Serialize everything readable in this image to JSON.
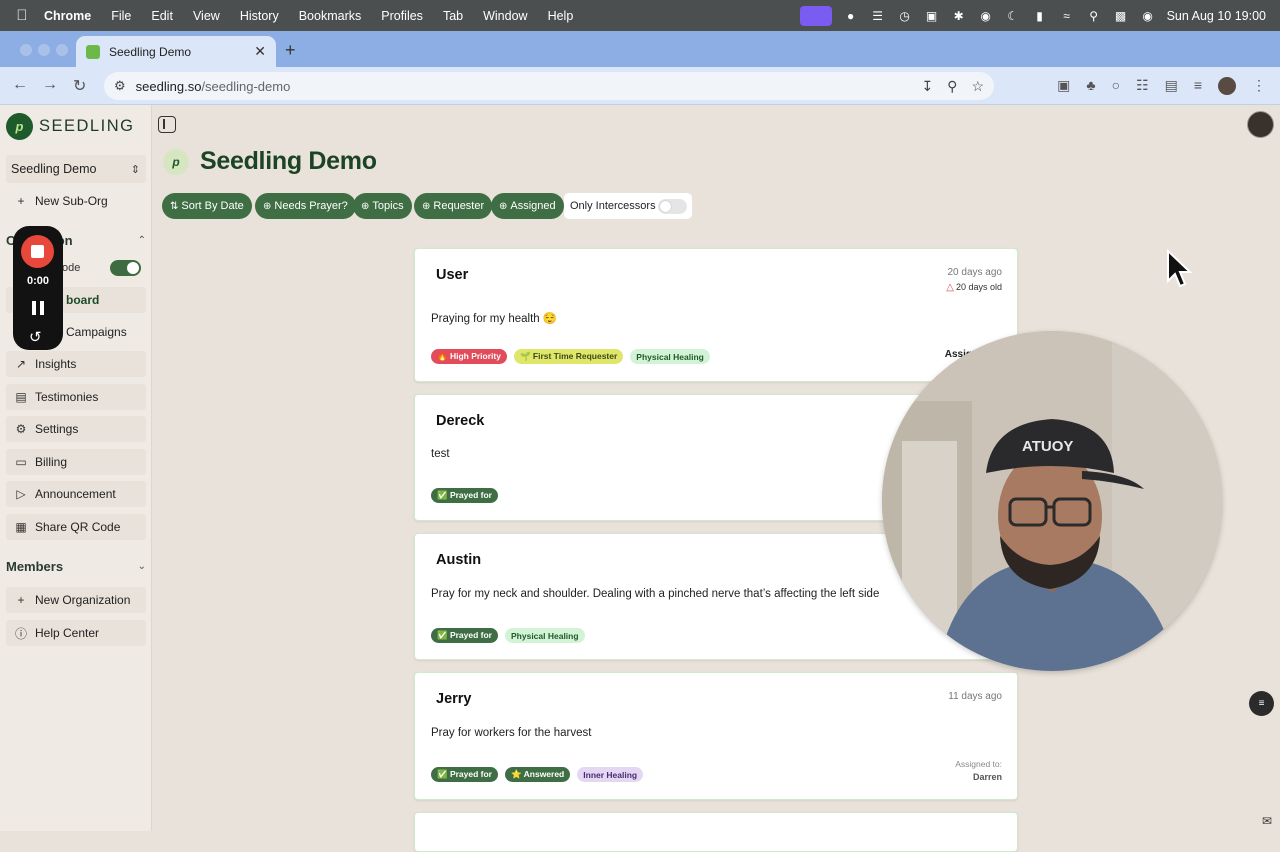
{
  "menubar": {
    "apple": "",
    "items": [
      "Chrome",
      "File",
      "Edit",
      "View",
      "History",
      "Bookmarks",
      "Profiles",
      "Tab",
      "Window",
      "Help"
    ],
    "datetime": "Sun Aug 10  19:00"
  },
  "browser": {
    "tab_title": "Seedling Demo",
    "url_host": "seedling.so",
    "url_path": "/seedling-demo"
  },
  "sidebar": {
    "brand": "SEEDLING",
    "brand_logo_glyph": "p",
    "org_selector": "Seedling Demo",
    "new_sub_org": "New Sub-Org",
    "section_org_partial_start": "O",
    "section_org_partial_end": "ion",
    "mode_partial": "ode",
    "dashboard_partial": "board",
    "campaigns_partial": "Campaigns",
    "items": [
      {
        "label": "Insights",
        "icon": "chart-icon"
      },
      {
        "label": "Testimonies",
        "icon": "book-icon"
      },
      {
        "label": "Settings",
        "icon": "gear-icon"
      },
      {
        "label": "Billing",
        "icon": "card-icon"
      },
      {
        "label": "Announcement",
        "icon": "megaphone-icon"
      },
      {
        "label": "Share QR Code",
        "icon": "qr-icon"
      }
    ],
    "members_section": "Members",
    "new_organization": "New Organization",
    "help_center": "Help Center"
  },
  "recorder": {
    "time": "0:00"
  },
  "main": {
    "title": "Seedling Demo",
    "filters": [
      "Sort By Date",
      "Needs Prayer?",
      "Topics",
      "Requester",
      "Assigned"
    ],
    "intercessors_label": "Only Intercessors",
    "intercessors_on": false
  },
  "requests": [
    {
      "name": "User",
      "ago": "20 days ago",
      "age_warning": "20 days old",
      "message": "Praying for my health 😌",
      "tags": [
        {
          "label": "🔥 High Priority",
          "kind": "high"
        },
        {
          "label": "🌱 First Time Requester",
          "kind": "first"
        },
        {
          "label": "Physical Healing",
          "kind": "phys"
        }
      ],
      "assign": "Assign T"
    },
    {
      "name": "Dereck",
      "message": "test",
      "tags": [
        {
          "label": "✅ Prayed for",
          "kind": "prayed"
        }
      ]
    },
    {
      "name": "Austin",
      "message": "Pray for my neck and shoulder. Dealing with a pinched nerve that’s affecting the left side",
      "tags": [
        {
          "label": "✅ Prayed for",
          "kind": "prayed"
        },
        {
          "label": "Physical Healing",
          "kind": "phys"
        }
      ]
    },
    {
      "name": "Jerry",
      "ago": "11 days ago",
      "message": "Pray for workers for the harvest",
      "tags": [
        {
          "label": "✅ Prayed for",
          "kind": "prayed"
        },
        {
          "label": "⭐ Answered",
          "kind": "answered"
        },
        {
          "label": "Inner Healing",
          "kind": "inner"
        }
      ],
      "assigned_label": "Assigned to:",
      "assigned_name": "Darren"
    }
  ]
}
